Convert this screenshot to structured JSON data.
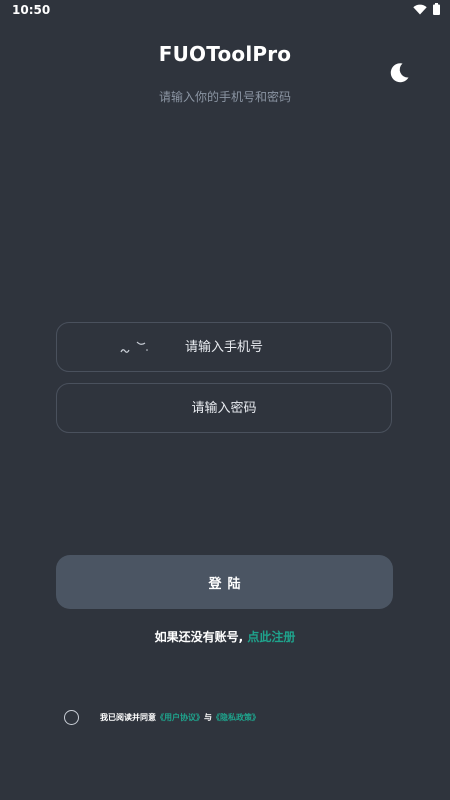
{
  "status_bar": {
    "time": "10:50",
    "icons": [
      "wifi-icon",
      "battery-icon"
    ]
  },
  "header": {
    "title": "FUOToolPro",
    "subtitle": "请输入你的手机号和密码",
    "theme_icon": "moon-icon"
  },
  "form": {
    "phone_placeholder": "请输入手机号",
    "password_placeholder": "请输入密码",
    "login_label": "登陆"
  },
  "register": {
    "prompt": "如果还没有账号, ",
    "link": "点此注册"
  },
  "agreement": {
    "prefix": "我已阅读并同意",
    "user_agreement": "《用户协议》",
    "and": "与",
    "privacy_policy": "《隐私政策》"
  },
  "colors": {
    "background": "#2f343d",
    "accent": "#1fa38c",
    "button": "#4b5563",
    "field_border": "#4a515d",
    "subtitle": "#8b95a3"
  }
}
